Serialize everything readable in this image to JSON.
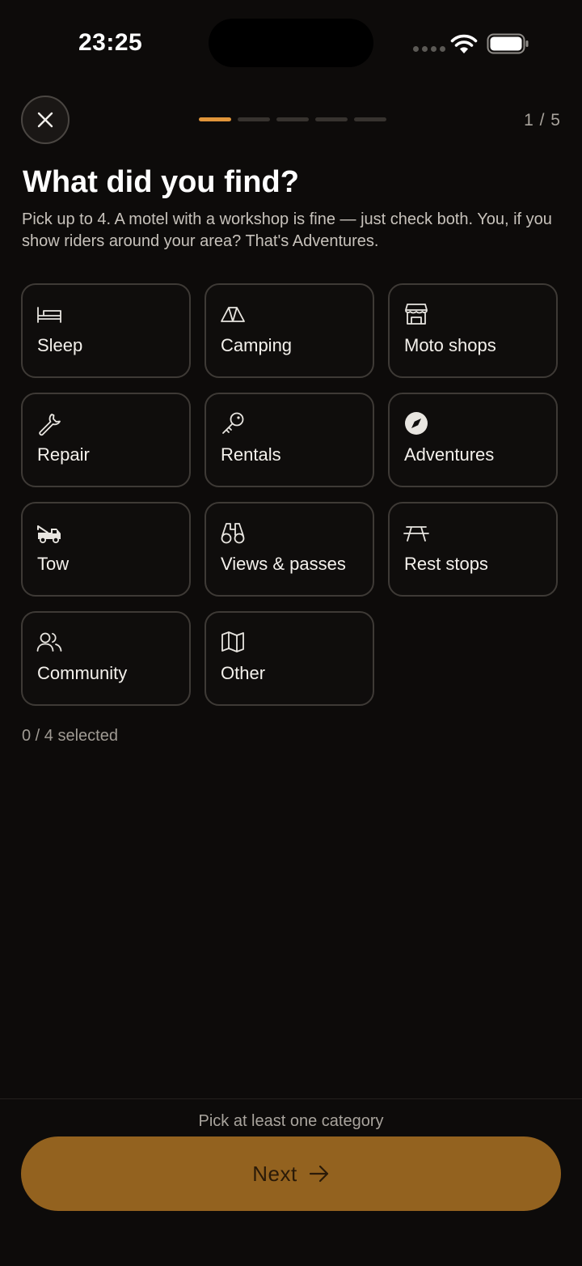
{
  "status_bar": {
    "time": "23:25"
  },
  "header": {
    "step_counter": "1 / 5",
    "progress": {
      "current": 1,
      "total": 5
    },
    "accent_color": "#e0953a"
  },
  "page": {
    "title": "What did you find?",
    "subtitle": "Pick up to 4. A motel with a workshop is fine — just check both. You, if you show riders around your area? That's Adventures."
  },
  "categories": [
    {
      "label": "Sleep",
      "icon": "bed-icon"
    },
    {
      "label": "Camping",
      "icon": "tent-icon"
    },
    {
      "label": "Moto shops",
      "icon": "store-icon"
    },
    {
      "label": "Repair",
      "icon": "wrench-icon"
    },
    {
      "label": "Rentals",
      "icon": "key-icon"
    },
    {
      "label": "Adventures",
      "icon": "compass-icon"
    },
    {
      "label": "Tow",
      "icon": "tow-truck-icon"
    },
    {
      "label": "Views & passes",
      "icon": "binoculars-icon"
    },
    {
      "label": "Rest stops",
      "icon": "picnic-table-icon"
    },
    {
      "label": "Community",
      "icon": "users-icon"
    },
    {
      "label": "Other",
      "icon": "map-icon"
    }
  ],
  "selection": {
    "count_text": "0 / 4 selected"
  },
  "footer": {
    "hint": "Pick at least one category",
    "next_label": "Next",
    "button_color": "#93621f"
  }
}
